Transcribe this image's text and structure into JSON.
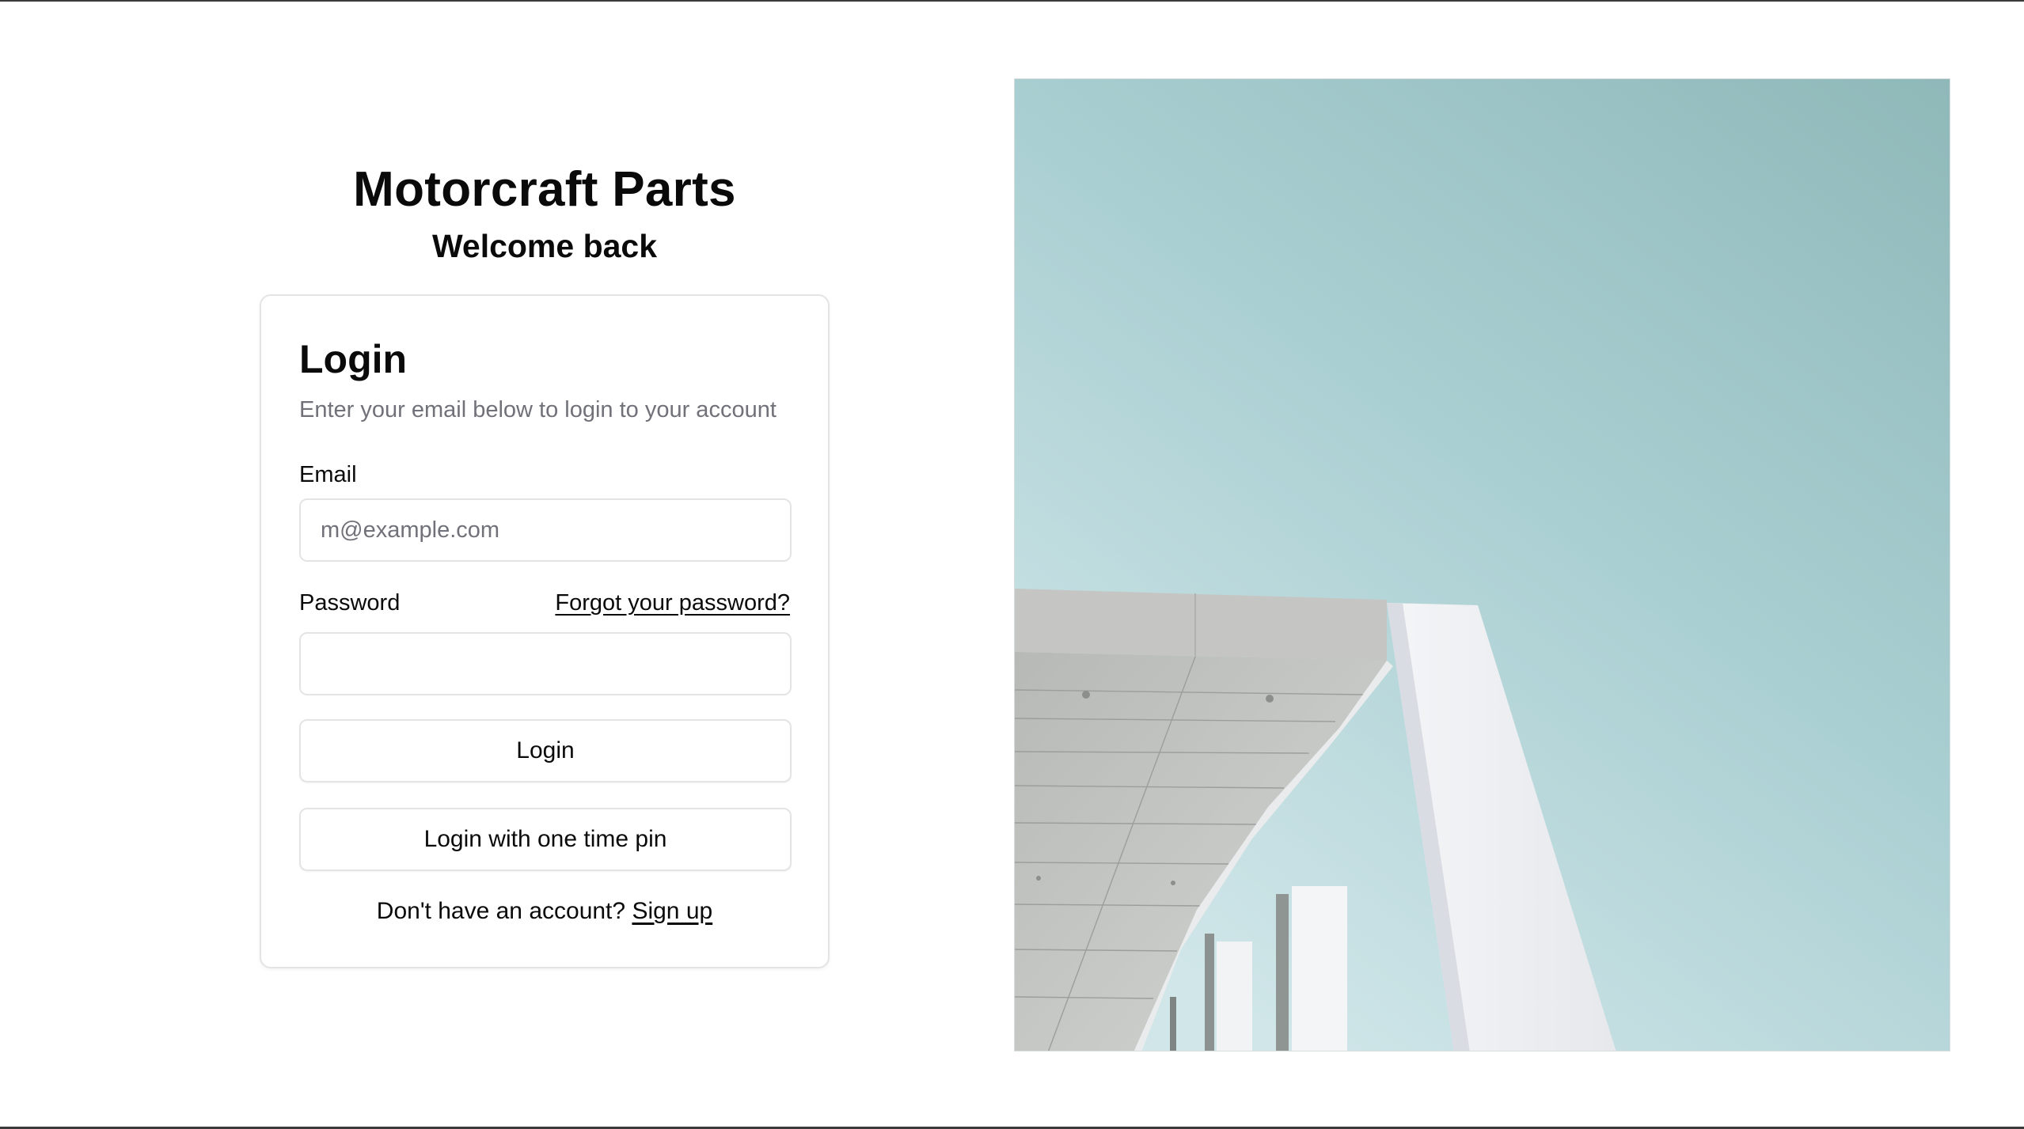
{
  "brand": {
    "title": "Motorcraft Parts",
    "subtitle": "Welcome back"
  },
  "login_card": {
    "title": "Login",
    "description": "Enter your email below to login to your account",
    "email_label": "Email",
    "email_placeholder": "m@example.com",
    "email_value": "",
    "password_label": "Password",
    "password_value": "",
    "forgot_password_link": "Forgot your password?",
    "login_button": "Login",
    "otp_button": "Login with one time pin",
    "signup_prompt": "Don't have an account?",
    "signup_link": "Sign up"
  },
  "hero_image": {
    "subject": "modern white building canopy against a pale teal sky",
    "sky_color_top": "#8fb8b9",
    "sky_color_bottom": "#d0e6e9"
  },
  "colors": {
    "text": "#0a0a0a",
    "muted_text": "#71717a",
    "border": "#e4e4e7",
    "background": "#ffffff"
  }
}
